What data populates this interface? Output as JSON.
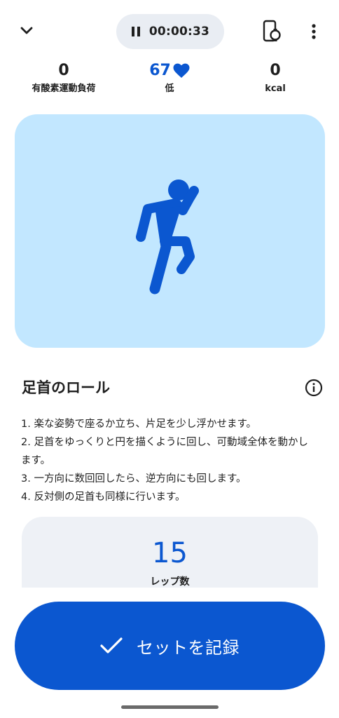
{
  "timer": {
    "icon": "pause-icon",
    "time": "00:00:33"
  },
  "header": {
    "collapse_icon": "chevron-down-icon",
    "watch_icon": "watch-phone-icon",
    "more_icon": "more-vert-icon"
  },
  "stats": [
    {
      "value": "0",
      "label": "有酸素運動負荷"
    },
    {
      "value": "67",
      "label": "低",
      "icon": "heart-icon",
      "accent": "#0b57d0"
    },
    {
      "value": "0",
      "label": "kcal"
    }
  ],
  "hero": {
    "icon": "running-person-icon",
    "background": "#c2e7ff",
    "figure_color": "#0b57d0"
  },
  "exercise": {
    "title": "足首のロール",
    "info_icon": "info-icon",
    "steps": [
      "1. 楽な姿勢で座るか立ち、片足を少し浮かせます。",
      "2. 足首をゆっくりと円を描くように回し、可動域全体を動かします。",
      "3. 一方向に数回回したら、逆方向にも回します。",
      "4. 反対側の足首も同様に行います。"
    ]
  },
  "reps": {
    "value": "15",
    "label": "レップ数"
  },
  "record_button": {
    "label": "セットを記録",
    "icon": "check-icon",
    "color": "#0b57d0"
  }
}
